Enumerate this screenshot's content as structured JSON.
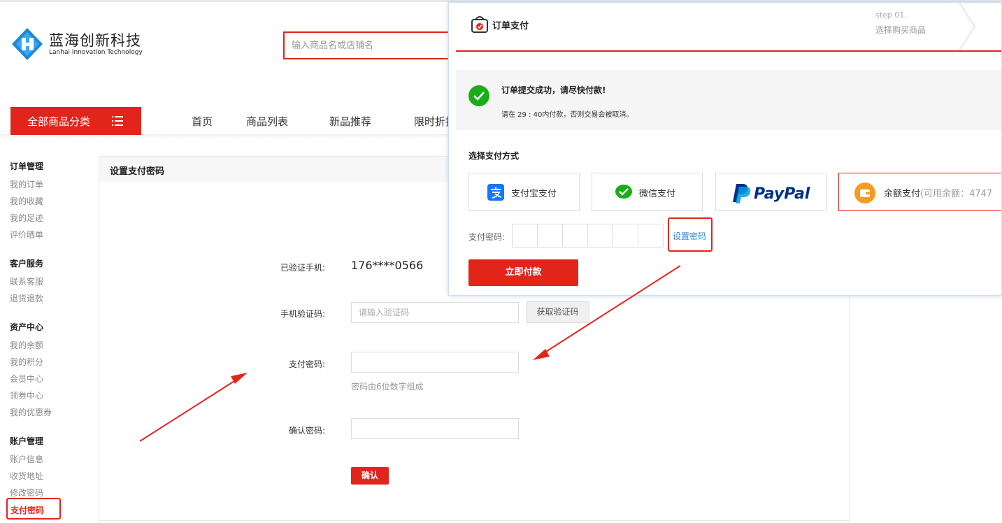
{
  "brand": {
    "name_cn": "蓝海创新科技",
    "name_en": "Lanhai Innovation Technology"
  },
  "search": {
    "placeholder": "输入商品名或店铺名"
  },
  "nav": {
    "all_categories": "全部商品分类",
    "items": [
      "首页",
      "商品列表",
      "新品推荐",
      "限时折扣"
    ]
  },
  "sidebar": {
    "groups": [
      {
        "title": "订单管理",
        "items": [
          "我的订单",
          "我的收藏",
          "我的足迹",
          "评价晒单"
        ]
      },
      {
        "title": "客户服务",
        "items": [
          "联系客服",
          "退货退款"
        ]
      },
      {
        "title": "资产中心",
        "items": [
          "我的余额",
          "我的积分",
          "会员中心",
          "领券中心",
          "我的优惠券"
        ]
      },
      {
        "title": "账户管理",
        "items": [
          "账户信息",
          "收货地址",
          "修改密码",
          "支付密码"
        ]
      }
    ]
  },
  "form": {
    "title": "设置支付密码",
    "verified_phone_label": "已验证手机:",
    "verified_phone_value": "176****0566",
    "sms_code_label": "手机验证码:",
    "sms_code_placeholder": "请输入验证码",
    "get_code_button": "获取验证码",
    "pay_password_label": "支付密码:",
    "pay_password_hint": "密码由6位数字组成",
    "confirm_password_label": "确认密码:",
    "confirm_button": "确认"
  },
  "popup": {
    "title": "订单支付",
    "step_number": "step 01.",
    "step_label": "选择购买商品",
    "success_title": "订单提交成功，请尽快付款!",
    "timer_text": "请在 29 : 40内付款，否则交易会被取消。",
    "method_title": "选择支付方式",
    "methods": [
      {
        "label": "支付宝支付",
        "icon": "alipay-icon"
      },
      {
        "label": "微信支付",
        "icon": "wechat-icon"
      },
      {
        "label": "PayPal",
        "icon": "paypal-logo"
      },
      {
        "label": "余额支付",
        "extra": "(可用余额：4747",
        "icon": "wallet-icon"
      }
    ],
    "password_label": "支付密码:",
    "set_password_link": "设置密码",
    "pay_now_button": "立即付款"
  },
  "colors": {
    "accent": "#e1251b",
    "link": "#2a8ad6",
    "success": "#1aad19",
    "wallet": "#f59a23"
  }
}
